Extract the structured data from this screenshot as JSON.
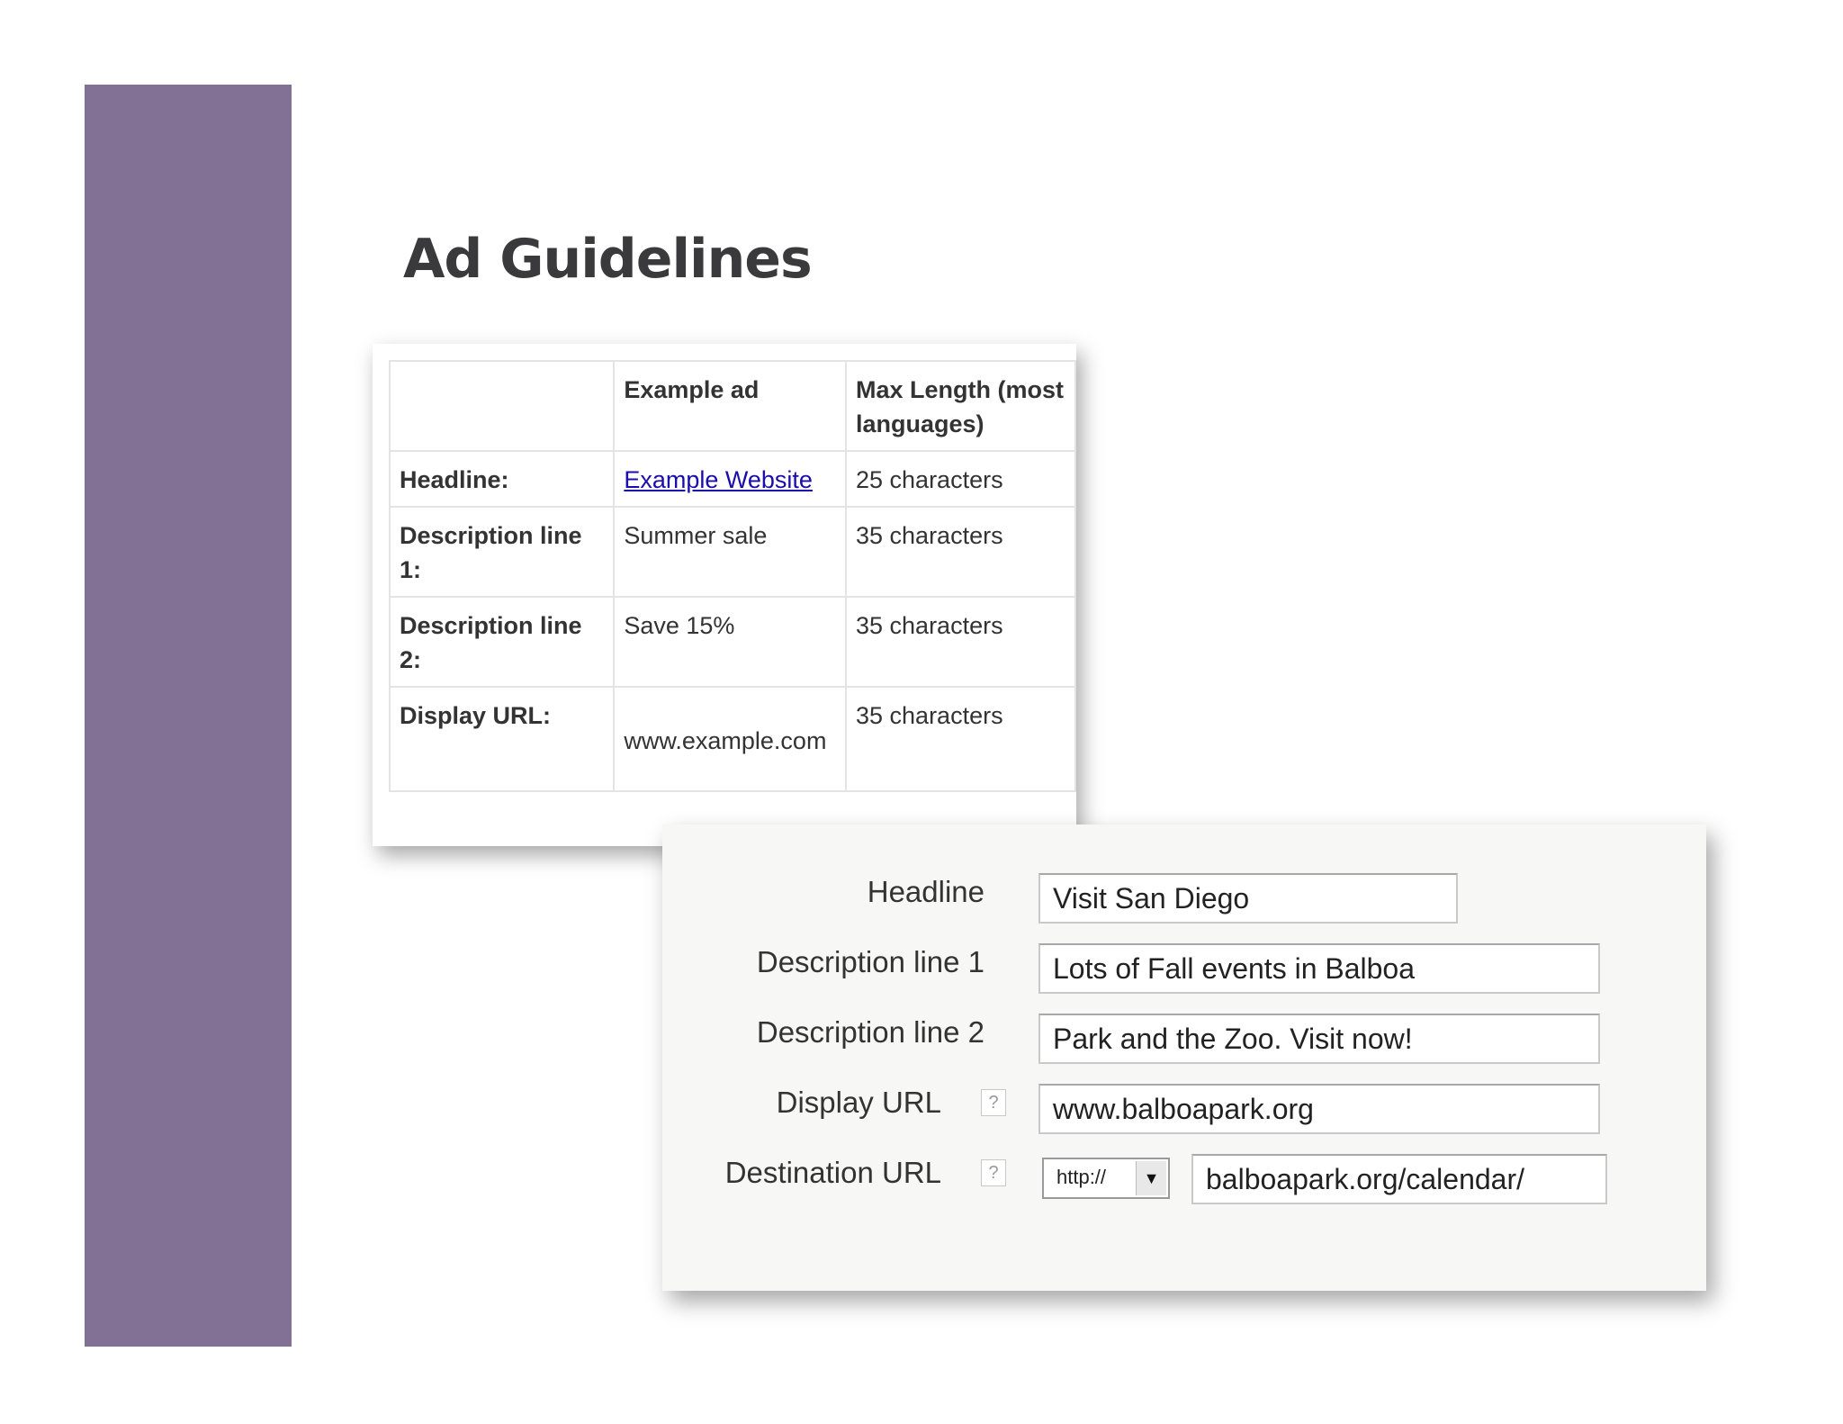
{
  "theme": {
    "accent": "#837195"
  },
  "slide": {
    "title": "Ad Guidelines"
  },
  "guidelines": {
    "headers": [
      "",
      "Example ad",
      "Max Length (most languages)"
    ],
    "rows": [
      {
        "label": "Headline:",
        "example": "Example Website",
        "max": "25 characters"
      },
      {
        "label": "Description line 1:",
        "example": "Summer sale",
        "max": "35 characters"
      },
      {
        "label": "Description line 2:",
        "example": "Save 15%",
        "max": "35 characters"
      },
      {
        "label": "Display URL:",
        "example": "www.example.com",
        "max": "35 characters"
      }
    ]
  },
  "ad_form": {
    "headline": {
      "label": "Headline",
      "value": "Visit San Diego"
    },
    "description1": {
      "label": "Description line 1",
      "value": "Lots of Fall events in Balboa"
    },
    "description2": {
      "label": "Description line 2",
      "value": "Park and the Zoo. Visit now!"
    },
    "display_url": {
      "label": "Display URL",
      "value": "www.balboapark.org",
      "help": "?"
    },
    "destination_url": {
      "label": "Destination URL",
      "protocol": "http://",
      "value": "balboapark.org/calendar/",
      "help": "?"
    }
  }
}
